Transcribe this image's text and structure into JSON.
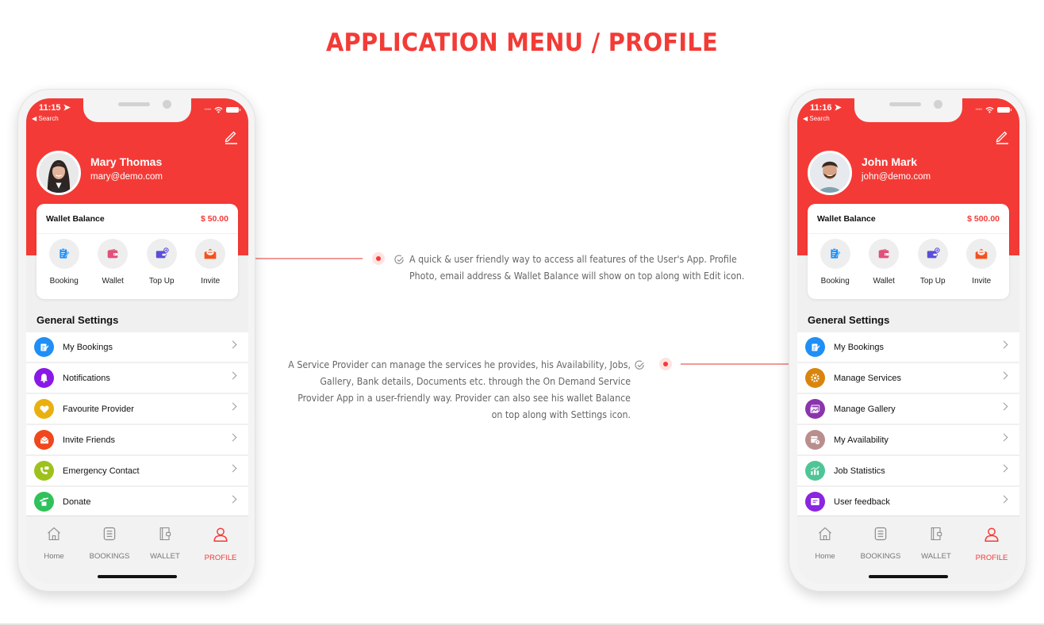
{
  "page": {
    "title": "APPLICATION MENU / PROFILE",
    "accent_color": "#f43a36"
  },
  "callouts": [
    {
      "lines": [
        "A quick & user friendly way to access all features of the User's App. Profile",
        "Photo, email address & Wallet Balance will show on top along with Edit icon."
      ]
    },
    {
      "lines": [
        "A Service Provider can manage the services he provides, his Availability, Jobs,",
        "Gallery, Bank details, Documents etc. through the On Demand Service",
        "Provider App in a user-friendly way. Provider can also see his wallet Balance",
        "on top along with Settings icon."
      ]
    }
  ],
  "phones": [
    {
      "status": {
        "time": "11:15",
        "back_label": "Search"
      },
      "profile": {
        "name": "Mary Thomas",
        "email": "mary@demo.com"
      },
      "wallet": {
        "label": "Wallet Balance",
        "amount": "$ 50.00"
      },
      "quick_actions": [
        {
          "label": "Booking",
          "icon": "clipboard-edit-icon",
          "color": "#1f8ff5"
        },
        {
          "label": "Wallet",
          "icon": "wallet-icon",
          "color": "#e0507a"
        },
        {
          "label": "Top Up",
          "icon": "wallet-add-icon",
          "color": "#5b4ed6"
        },
        {
          "label": "Invite",
          "icon": "envelope-open-icon",
          "color": "#f2521e"
        }
      ],
      "section_title": "General Settings",
      "menu": [
        {
          "label": "My Bookings",
          "icon": "clipboard-edit-icon",
          "color": "#1f8ff5"
        },
        {
          "label": "Notifications",
          "icon": "bell-icon",
          "color": "#8a18e6"
        },
        {
          "label": "Favourite Provider",
          "icon": "heart-icon",
          "color": "#eab010"
        },
        {
          "label": "Invite Friends",
          "icon": "envelope-open-icon",
          "color": "#f0471d"
        },
        {
          "label": "Emergency Contact",
          "icon": "phone-chat-icon",
          "color": "#9ec21b"
        },
        {
          "label": "Donate",
          "icon": "donate-hand-icon",
          "color": "#2fc25a"
        }
      ],
      "tabs": [
        {
          "label": "Home",
          "icon": "home-icon",
          "active": false
        },
        {
          "label": "BOOKINGS",
          "icon": "list-icon",
          "active": false
        },
        {
          "label": "WALLET",
          "icon": "wallet-outline-icon",
          "active": false
        },
        {
          "label": "PROFILE",
          "icon": "user-icon",
          "active": true
        }
      ]
    },
    {
      "status": {
        "time": "11:16",
        "back_label": "Search"
      },
      "profile": {
        "name": "John Mark",
        "email": "john@demo.com"
      },
      "wallet": {
        "label": "Wallet Balance",
        "amount": "$ 500.00"
      },
      "quick_actions": [
        {
          "label": "Booking",
          "icon": "clipboard-edit-icon",
          "color": "#1f8ff5"
        },
        {
          "label": "Wallet",
          "icon": "wallet-icon",
          "color": "#e0507a"
        },
        {
          "label": "Top Up",
          "icon": "wallet-add-icon",
          "color": "#5b4ed6"
        },
        {
          "label": "Invite",
          "icon": "envelope-open-icon",
          "color": "#f2521e"
        }
      ],
      "section_title": "General Settings",
      "menu": [
        {
          "label": "My Bookings",
          "icon": "clipboard-edit-icon",
          "color": "#1f8ff5"
        },
        {
          "label": "Manage Services",
          "icon": "gear-icon",
          "color": "#d9850d"
        },
        {
          "label": "Manage Gallery",
          "icon": "gallery-icon",
          "color": "#8a35ad"
        },
        {
          "label": "My Availability",
          "icon": "calendar-clock-icon",
          "color": "#b98f8d"
        },
        {
          "label": "Job Statistics",
          "icon": "bar-chart-icon",
          "color": "#4fc597"
        },
        {
          "label": "User feedback",
          "icon": "feedback-icon",
          "color": "#8a25e0"
        }
      ],
      "tabs": [
        {
          "label": "Home",
          "icon": "home-icon",
          "active": false
        },
        {
          "label": "BOOKINGS",
          "icon": "list-icon",
          "active": false
        },
        {
          "label": "WALLET",
          "icon": "wallet-outline-icon",
          "active": false
        },
        {
          "label": "PROFILE",
          "icon": "user-icon",
          "active": true
        }
      ]
    }
  ]
}
